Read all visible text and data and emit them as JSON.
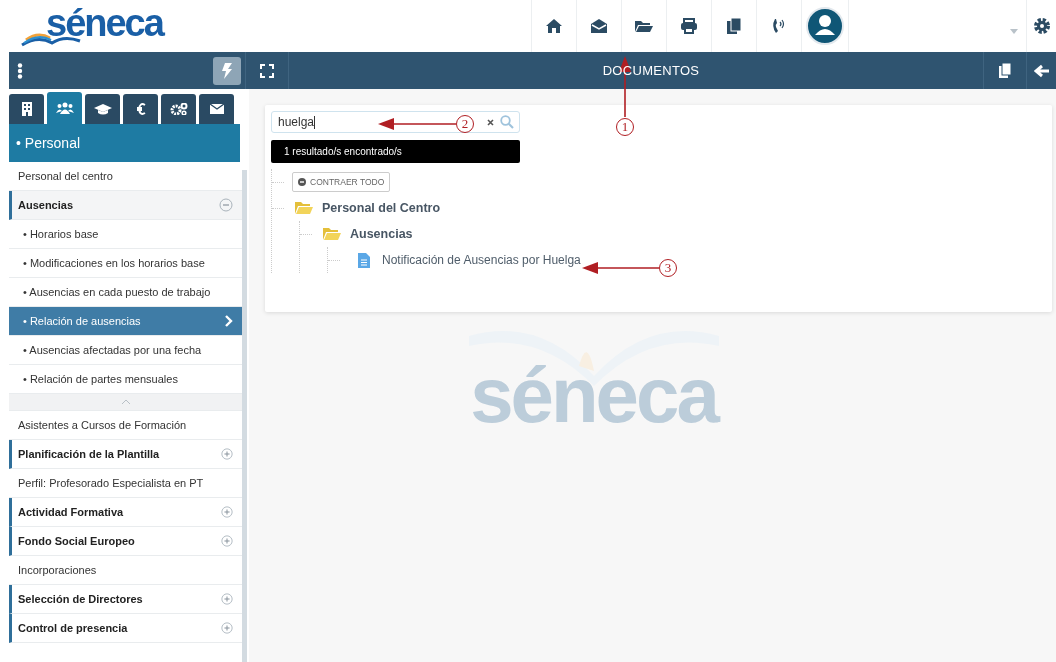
{
  "header": {
    "logo": "séneca"
  },
  "page_bar": {
    "title": "DOCUMENTOS"
  },
  "sidebar": {
    "tabs": [
      {
        "selected": false
      },
      {
        "selected": true
      },
      {
        "selected": false
      },
      {
        "selected": false
      },
      {
        "selected": false
      },
      {
        "selected": false
      }
    ],
    "section_title": "• Personal",
    "items": [
      {
        "label": "Personal del centro",
        "kind": "item"
      },
      {
        "label": "Ausencias",
        "kind": "group",
        "expanded": true,
        "children": [
          {
            "label": "• Horarios base",
            "selected": false
          },
          {
            "label": "• Modificaciones en los horarios base",
            "selected": false
          },
          {
            "label": "• Ausencias en cada puesto de trabajo",
            "selected": false
          },
          {
            "label": "• Relación de ausencias",
            "selected": true
          },
          {
            "label": "• Ausencias afectadas por una fecha",
            "selected": false
          },
          {
            "label": "• Relación de partes mensuales",
            "selected": false
          }
        ]
      },
      {
        "label": "Asistentes a Cursos de Formación",
        "kind": "item"
      },
      {
        "label": "Planificación de la Plantilla",
        "kind": "group",
        "expanded": false
      },
      {
        "label": "Perfil: Profesorado Especialista en PT",
        "kind": "item"
      },
      {
        "label": "Actividad Formativa",
        "kind": "group",
        "expanded": false
      },
      {
        "label": "Fondo Social Europeo",
        "kind": "group",
        "expanded": false
      },
      {
        "label": "Incorporaciones",
        "kind": "item"
      },
      {
        "label": "Selección de Directores",
        "kind": "group",
        "expanded": false
      },
      {
        "label": "Control de presencia",
        "kind": "group",
        "expanded": false
      }
    ]
  },
  "search": {
    "value": "huelga",
    "result": "1 resultado/s encontrado/s"
  },
  "collapse_all": "CONTRAER TODO",
  "tree": [
    {
      "label": "Personal del Centro",
      "kind": "folder",
      "children": [
        {
          "label": "Ausencias",
          "kind": "folder",
          "children": [
            {
              "label": "Notificación de Ausencias por Huelga",
              "kind": "document"
            }
          ]
        }
      ]
    }
  ],
  "background_logo": "séneca",
  "annotations": [
    {
      "label": "1"
    },
    {
      "label": "2"
    },
    {
      "label": "3"
    }
  ]
}
